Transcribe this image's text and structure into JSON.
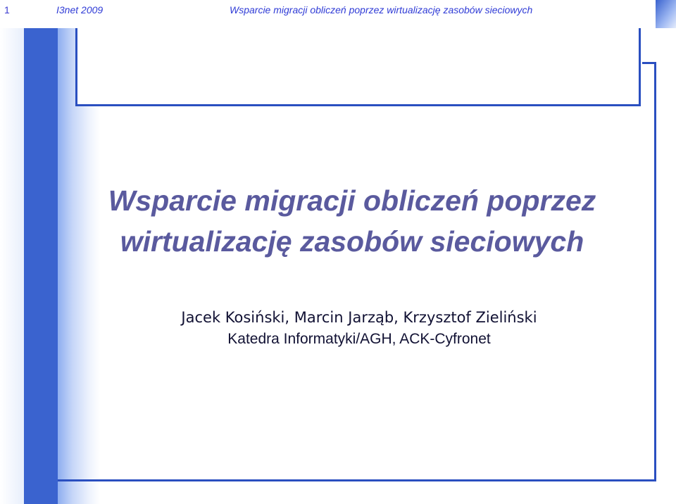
{
  "header": {
    "page_number": "1",
    "conference": "I3net 2009",
    "running_title": "Wsparcie migracji obliczeń poprzez wirtualizację zasobów sieciowych"
  },
  "title": {
    "line1": "Wsparcie migracji obliczeń poprzez",
    "line2": "wirtualizację zasobów sieciowych"
  },
  "authors": "Jacek Kosiński, Marcin Jarząb, Krzysztof Zieliński",
  "affiliation": "Katedra Informatyki/AGH, ACK-Cyfronet",
  "colors": {
    "frame_blue": "#2a4fc0",
    "band_blue": "#3a63cf",
    "title_color": "#5a5a9e",
    "header_text": "#2f3bd6"
  }
}
